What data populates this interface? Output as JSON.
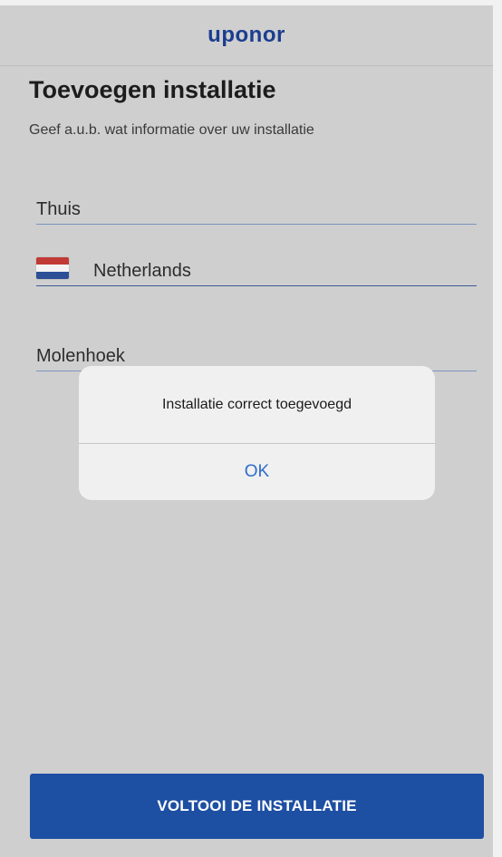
{
  "header": {
    "logo_text": "uponor"
  },
  "page": {
    "title": "Toevoegen installatie",
    "subtitle": "Geef a.u.b. wat informatie over uw installatie"
  },
  "form": {
    "name_value": "Thuis",
    "country_value": "Netherlands",
    "country_flag": "netherlands-flag-icon",
    "city_value": "Molenhoek"
  },
  "dialog": {
    "message": "Installatie correct toegevoegd",
    "ok_label": "OK"
  },
  "footer": {
    "cta_label": "VOLTOOI DE INSTALLATIE"
  },
  "colors": {
    "brand": "#1a3d8f",
    "cta": "#1d4fa3",
    "dialog_link": "#2f6ccb"
  }
}
